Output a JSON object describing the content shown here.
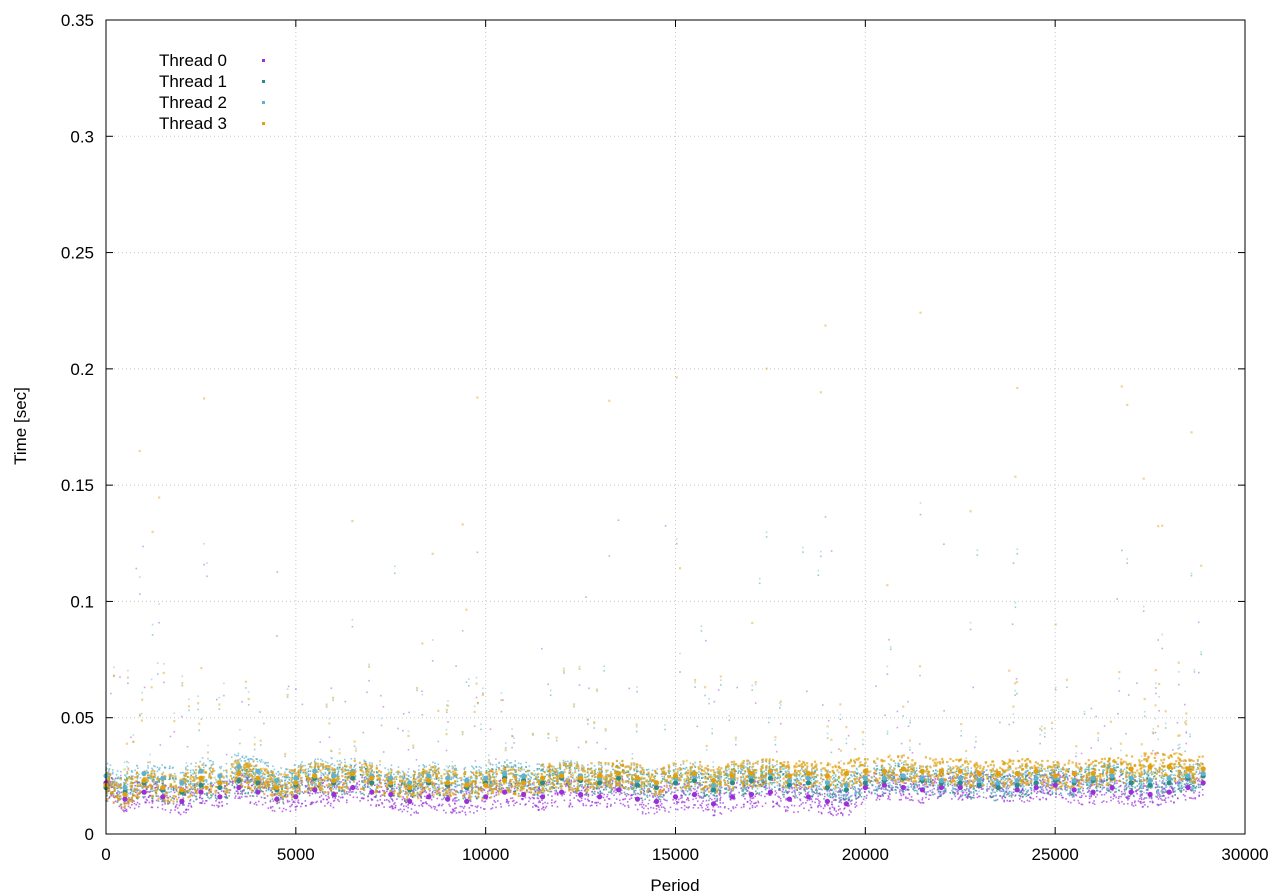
{
  "chart_data": {
    "type": "scatter",
    "title": "",
    "xlabel": "Period",
    "ylabel": "Time [sec]",
    "xlim": [
      0,
      30000
    ],
    "ylim": [
      0,
      0.35
    ],
    "x_ticks": [
      0,
      5000,
      10000,
      15000,
      20000,
      25000,
      30000
    ],
    "x_tick_labels": [
      "0",
      "5000",
      "10000",
      "15000",
      "20000",
      "25000",
      "30000"
    ],
    "y_ticks": [
      0,
      0.05,
      0.1,
      0.15,
      0.2,
      0.25,
      0.3,
      0.35
    ],
    "y_tick_labels": [
      "0",
      "0.05",
      "0.1",
      "0.15",
      "0.2",
      "0.25",
      "0.3",
      "0.35"
    ],
    "grid": true,
    "legend_position": "top-left",
    "series": [
      {
        "name": "Thread 0",
        "color": "#9b30d9",
        "x": [
          0,
          500,
          1000,
          1500,
          2000,
          2500,
          3000,
          3500,
          4000,
          4500,
          5000,
          5500,
          6000,
          6500,
          7000,
          7500,
          8000,
          8500,
          9000,
          9500,
          10000,
          10500,
          11000,
          11500,
          12000,
          12500,
          13000,
          13500,
          14000,
          14500,
          15000,
          15500,
          16000,
          16500,
          17000,
          17500,
          18000,
          18500,
          19000,
          19500,
          20000,
          20500,
          21000,
          21500,
          22000,
          22500,
          23000,
          23500,
          24000,
          24500,
          25000,
          25500,
          26000,
          26500,
          27000,
          27500,
          28000,
          28500,
          28900
        ],
        "y": [
          0.022,
          0.015,
          0.018,
          0.016,
          0.014,
          0.018,
          0.016,
          0.02,
          0.018,
          0.015,
          0.016,
          0.019,
          0.017,
          0.02,
          0.018,
          0.017,
          0.014,
          0.016,
          0.015,
          0.014,
          0.016,
          0.018,
          0.017,
          0.016,
          0.018,
          0.017,
          0.016,
          0.019,
          0.015,
          0.014,
          0.016,
          0.017,
          0.013,
          0.016,
          0.017,
          0.018,
          0.015,
          0.016,
          0.014,
          0.013,
          0.02,
          0.021,
          0.02,
          0.019,
          0.02,
          0.02,
          0.021,
          0.02,
          0.019,
          0.02,
          0.021,
          0.019,
          0.018,
          0.02,
          0.018,
          0.017,
          0.018,
          0.02,
          0.022
        ]
      },
      {
        "name": "Thread 1",
        "color": "#2e8b8b",
        "x": [
          0,
          500,
          1000,
          1500,
          2000,
          2500,
          3000,
          3500,
          4000,
          4500,
          5000,
          5500,
          6000,
          6500,
          7000,
          7500,
          8000,
          8500,
          9000,
          9500,
          10000,
          10500,
          11000,
          11500,
          12000,
          12500,
          13000,
          13500,
          14000,
          14500,
          15000,
          15500,
          16000,
          16500,
          17000,
          17500,
          18000,
          18500,
          19000,
          19500,
          20000,
          20500,
          21000,
          21500,
          22000,
          22500,
          23000,
          23500,
          24000,
          24500,
          25000,
          25500,
          26000,
          26500,
          27000,
          27500,
          28000,
          28500,
          28900
        ],
        "y": [
          0.02,
          0.018,
          0.022,
          0.019,
          0.018,
          0.021,
          0.02,
          0.023,
          0.022,
          0.019,
          0.021,
          0.024,
          0.022,
          0.024,
          0.022,
          0.021,
          0.019,
          0.022,
          0.021,
          0.02,
          0.022,
          0.024,
          0.023,
          0.022,
          0.024,
          0.023,
          0.022,
          0.024,
          0.021,
          0.02,
          0.022,
          0.023,
          0.019,
          0.022,
          0.023,
          0.024,
          0.021,
          0.022,
          0.02,
          0.019,
          0.022,
          0.023,
          0.024,
          0.023,
          0.022,
          0.022,
          0.021,
          0.02,
          0.021,
          0.022,
          0.023,
          0.022,
          0.023,
          0.024,
          0.022,
          0.021,
          0.022,
          0.024,
          0.025
        ]
      },
      {
        "name": "Thread 2",
        "color": "#5fb3d0",
        "x": [
          0,
          500,
          1000,
          1500,
          2000,
          2500,
          3000,
          3500,
          4000,
          4500,
          5000,
          5500,
          6000,
          6500,
          7000,
          7500,
          8000,
          8500,
          9000,
          9500,
          10000,
          10500,
          11000,
          11500,
          12000,
          12500,
          13000,
          13500,
          14000,
          14500,
          15000,
          15500,
          16000,
          16500,
          17000,
          17500,
          18000,
          18500,
          19000,
          19500,
          20000,
          20500,
          21000,
          21500,
          22000,
          22500,
          23000,
          23500,
          24000,
          24500,
          25000,
          25500,
          26000,
          26500,
          27000,
          27500,
          28000,
          28500,
          28900
        ],
        "y": [
          0.025,
          0.02,
          0.026,
          0.024,
          0.022,
          0.027,
          0.025,
          0.029,
          0.027,
          0.023,
          0.024,
          0.027,
          0.025,
          0.027,
          0.025,
          0.024,
          0.022,
          0.025,
          0.024,
          0.023,
          0.024,
          0.026,
          0.025,
          0.024,
          0.026,
          0.025,
          0.024,
          0.026,
          0.023,
          0.022,
          0.024,
          0.025,
          0.021,
          0.024,
          0.025,
          0.026,
          0.023,
          0.024,
          0.022,
          0.021,
          0.024,
          0.024,
          0.025,
          0.024,
          0.023,
          0.024,
          0.023,
          0.022,
          0.023,
          0.024,
          0.024,
          0.023,
          0.024,
          0.025,
          0.024,
          0.023,
          0.024,
          0.025,
          0.026
        ]
      },
      {
        "name": "Thread 3",
        "color": "#e0a010",
        "x": [
          0,
          500,
          1000,
          1500,
          2000,
          2500,
          3000,
          3500,
          4000,
          4500,
          5000,
          5500,
          6000,
          6500,
          7000,
          7500,
          8000,
          8500,
          9000,
          9500,
          10000,
          10500,
          11000,
          11500,
          12000,
          12500,
          13000,
          13500,
          14000,
          14500,
          15000,
          15500,
          16000,
          16500,
          17000,
          17500,
          18000,
          18500,
          19000,
          19500,
          20000,
          20500,
          21000,
          21500,
          22000,
          22500,
          23000,
          23500,
          24000,
          24500,
          25000,
          25500,
          26000,
          26500,
          27000,
          27500,
          28000,
          28500,
          28900
        ],
        "y": [
          0.021,
          0.017,
          0.023,
          0.02,
          0.019,
          0.024,
          0.022,
          0.026,
          0.024,
          0.02,
          0.022,
          0.025,
          0.023,
          0.026,
          0.024,
          0.022,
          0.02,
          0.023,
          0.022,
          0.021,
          0.021,
          0.023,
          0.022,
          0.024,
          0.025,
          0.024,
          0.025,
          0.026,
          0.024,
          0.022,
          0.025,
          0.026,
          0.023,
          0.025,
          0.026,
          0.027,
          0.025,
          0.026,
          0.025,
          0.026,
          0.027,
          0.027,
          0.028,
          0.027,
          0.027,
          0.027,
          0.026,
          0.026,
          0.026,
          0.027,
          0.025,
          0.026,
          0.026,
          0.027,
          0.028,
          0.029,
          0.029,
          0.028,
          0.028
        ]
      }
    ]
  }
}
